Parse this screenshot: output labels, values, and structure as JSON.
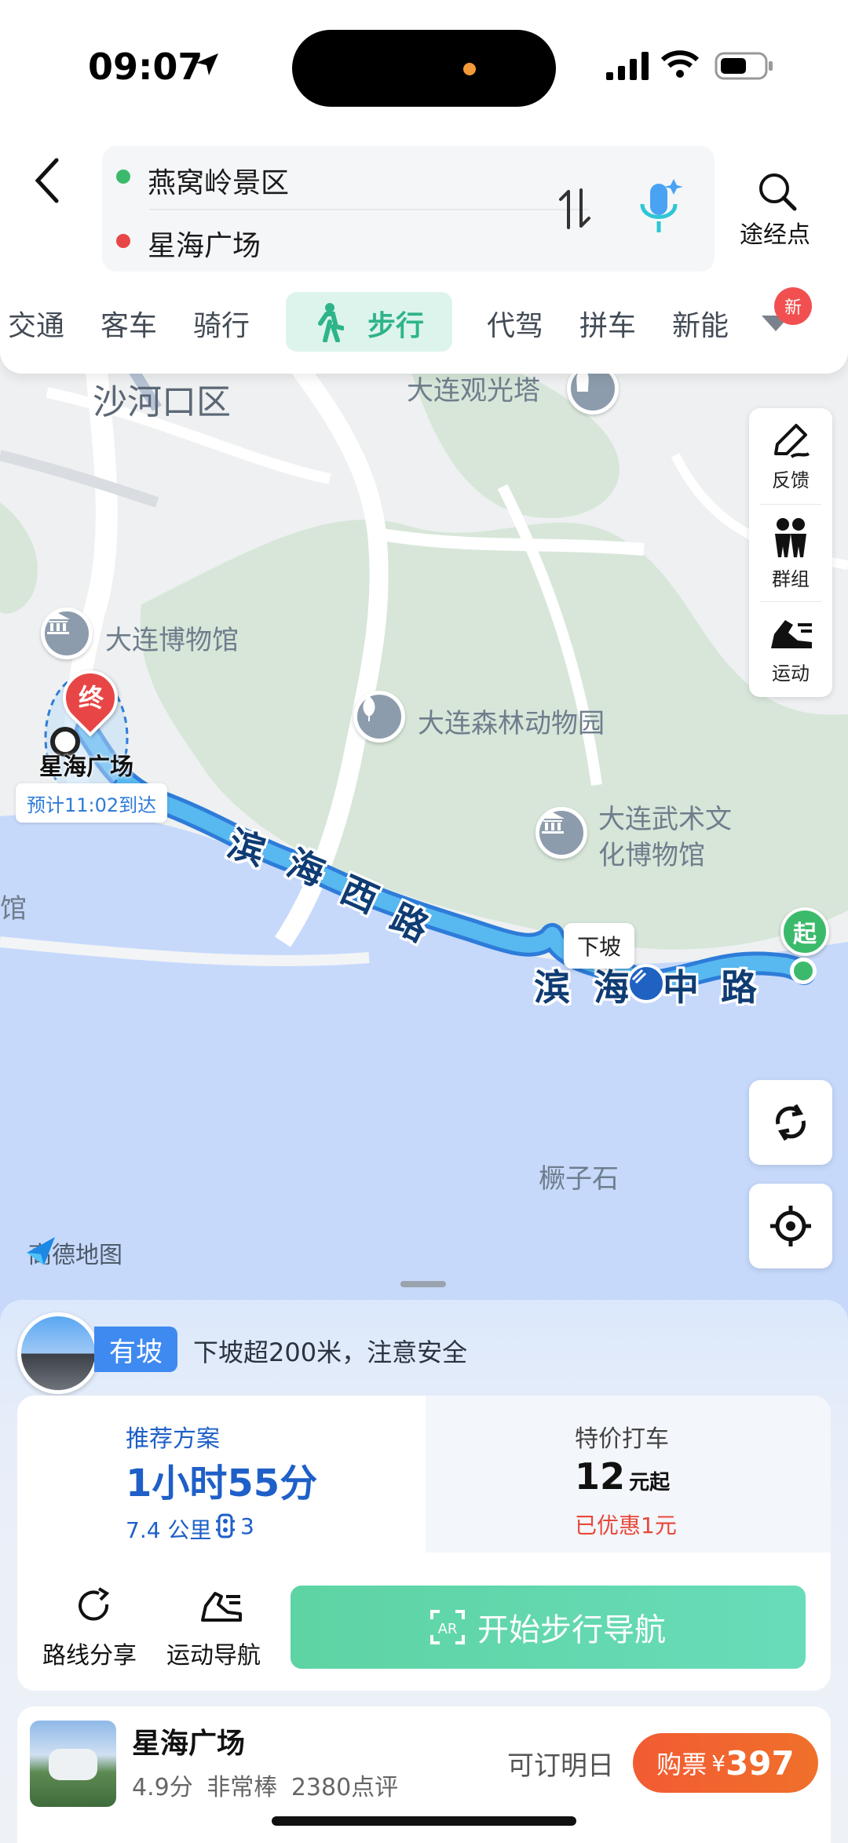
{
  "status_bar": {
    "time": "09:07"
  },
  "route": {
    "origin": "燕窝岭景区",
    "destination": "星海广场",
    "waypoint_label": "途经点"
  },
  "colors": {
    "origin_dot": "#3cba6b",
    "dest_dot": "#e84646",
    "accent": "#1e5fc8",
    "walk_green": "#2fb48a",
    "buy": "#f25b33"
  },
  "mode_tabs": {
    "items": [
      "交通",
      "客车",
      "骑行",
      "步行",
      "代驾",
      "拼车",
      "新能"
    ],
    "active": "步行",
    "new_badge": "新"
  },
  "map": {
    "labels": {
      "district": "沙河口区",
      "tower": "大连观光塔",
      "museum": "大连博物馆",
      "zoo": "大连森林动物园",
      "martial": "大连武术文",
      "martial2": "化博物馆",
      "edge": "馆",
      "rock": "橛子石",
      "road_west": [
        "滨",
        "海",
        "西",
        "路"
      ],
      "road_mid": [
        "滨",
        "海",
        "中",
        "路"
      ],
      "downhill": "下坡",
      "end_pin": "终",
      "start_pin": "起",
      "end_name": "星海广场",
      "eta": "预计11:02到达",
      "brand": "高德地图"
    },
    "tools": [
      "反馈",
      "群组",
      "运动"
    ]
  },
  "slope": {
    "tag": "有坡",
    "message": "下坡超200米，注意安全"
  },
  "plans": {
    "recommended": {
      "title": "推荐方案",
      "duration": "1小时55分",
      "distance": "7.4 公里",
      "lights": "3"
    },
    "taxi": {
      "title": "特价打车",
      "price": "12",
      "unit": "元起",
      "discount": "已优惠1元"
    }
  },
  "actions": {
    "share": "路线分享",
    "sport_nav": "运动导航",
    "start": "开始步行导航"
  },
  "poi": {
    "name": "星海广场",
    "rating": "4.9分",
    "rating_word": "非常棒",
    "reviews": "2380点评",
    "bookable": "可订明日",
    "buy_label": "购票",
    "currency": "¥",
    "price": "397"
  }
}
